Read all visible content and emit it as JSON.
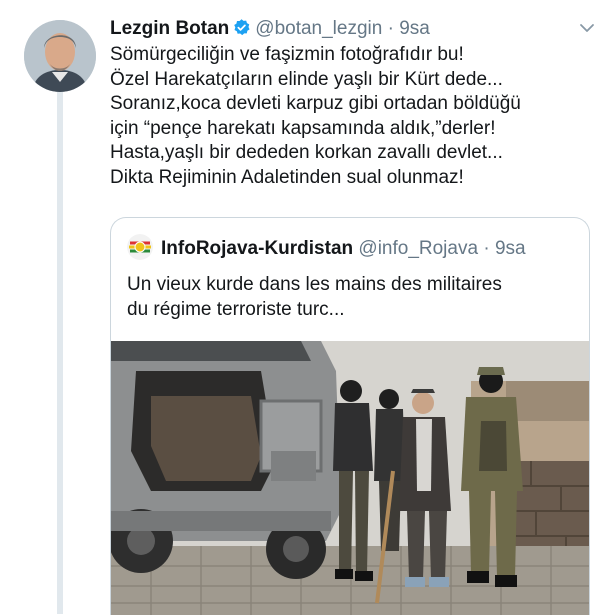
{
  "tweet": {
    "author_name": "Lezgin Botan",
    "handle": "@botan_lezgin",
    "separator": "·",
    "time": "9sa",
    "lines": [
      "Sömürgeciliğin ve faşizmin fotoğrafıdır bu!",
      "Özel Harekatçıların elinde yaşlı bir Kürt dede...",
      "Soranız,koca devleti karpuz gibi ortadan böldüğü",
      "için “pençe harekatı kapsamında aldık,”derler!",
      "Hasta,yaşlı bir dededen korkan zavallı devlet...",
      "Dikta Rejiminin Adaletinden sual olunmaz!"
    ],
    "icons": {
      "verified": "verified-badge-icon",
      "menu": "chevron-down-icon"
    }
  },
  "quoted_tweet": {
    "author_name": "InfoRojava-Kurdistan",
    "handle": "@info_Rojava",
    "separator": "·",
    "time": "9sa",
    "lines": [
      "Un vieux kurde dans les mains des militaires",
      "du régime terroriste turc..."
    ]
  },
  "colors": {
    "text": "#14171a",
    "secondary": "#657786",
    "verified": "#1da1f2",
    "border": "#ccd6dd",
    "thread": "#e1e8ed"
  }
}
